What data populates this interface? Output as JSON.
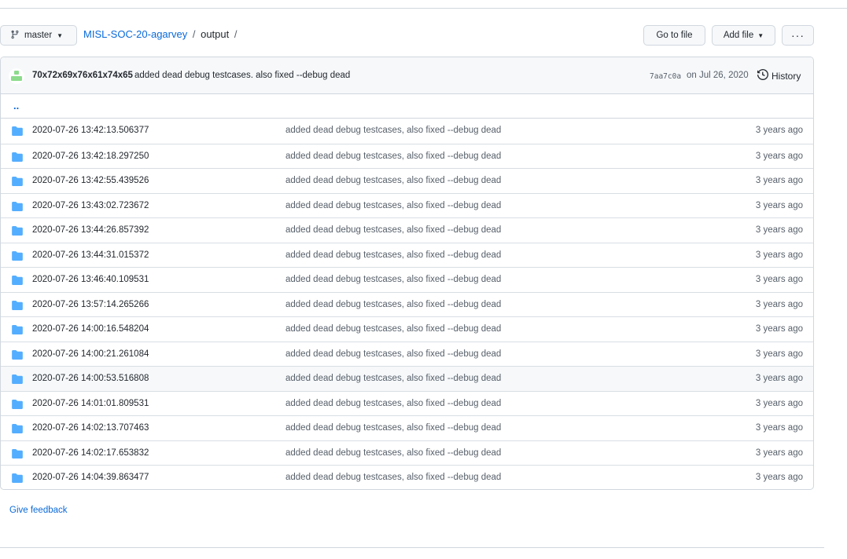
{
  "branch": {
    "name": "master",
    "icon": "git-branch-icon"
  },
  "breadcrumb": {
    "repo": "MISL-SOC-20-agarvey",
    "sep1": "/",
    "folder": "output",
    "sep2": "/"
  },
  "actions": {
    "go_to_file": "Go to file",
    "add_file": "Add file",
    "more": "···"
  },
  "commit": {
    "author": "70x72x69x76x61x74x65",
    "message": "added dead debug testcases. also fixed --debug dead",
    "sha": "7aa7c0a",
    "date": "on Jul 26, 2020",
    "history_label": "History"
  },
  "parent_link": "..",
  "files": [
    {
      "name": "2020-07-26 13:42:13.506377",
      "message": "added dead debug testcases, also fixed --debug dead",
      "age": "3 years ago"
    },
    {
      "name": "2020-07-26 13:42:18.297250",
      "message": "added dead debug testcases, also fixed --debug dead",
      "age": "3 years ago"
    },
    {
      "name": "2020-07-26 13:42:55.439526",
      "message": "added dead debug testcases, also fixed --debug dead",
      "age": "3 years ago"
    },
    {
      "name": "2020-07-26 13:43:02.723672",
      "message": "added dead debug testcases, also fixed --debug dead",
      "age": "3 years ago"
    },
    {
      "name": "2020-07-26 13:44:26.857392",
      "message": "added dead debug testcases, also fixed --debug dead",
      "age": "3 years ago"
    },
    {
      "name": "2020-07-26 13:44:31.015372",
      "message": "added dead debug testcases, also fixed --debug dead",
      "age": "3 years ago"
    },
    {
      "name": "2020-07-26 13:46:40.109531",
      "message": "added dead debug testcases, also fixed --debug dead",
      "age": "3 years ago"
    },
    {
      "name": "2020-07-26 13:57:14.265266",
      "message": "added dead debug testcases, also fixed --debug dead",
      "age": "3 years ago"
    },
    {
      "name": "2020-07-26 14:00:16.548204",
      "message": "added dead debug testcases, also fixed --debug dead",
      "age": "3 years ago"
    },
    {
      "name": "2020-07-26 14:00:21.261084",
      "message": "added dead debug testcases, also fixed --debug dead",
      "age": "3 years ago"
    },
    {
      "name": "2020-07-26 14:00:53.516808",
      "message": "added dead debug testcases, also fixed --debug dead",
      "age": "3 years ago"
    },
    {
      "name": "2020-07-26 14:01:01.809531",
      "message": "added dead debug testcases, also fixed --debug dead",
      "age": "3 years ago"
    },
    {
      "name": "2020-07-26 14:02:13.707463",
      "message": "added dead debug testcases, also fixed --debug dead",
      "age": "3 years ago"
    },
    {
      "name": "2020-07-26 14:02:17.653832",
      "message": "added dead debug testcases, also fixed --debug dead",
      "age": "3 years ago"
    },
    {
      "name": "2020-07-26 14:04:39.863477",
      "message": "added dead debug testcases, also fixed --debug dead",
      "age": "3 years ago"
    }
  ],
  "feedback": "Give feedback",
  "colors": {
    "accent": "#0969da",
    "folder": "#54aeff",
    "avatar": "#8ddb8c"
  }
}
